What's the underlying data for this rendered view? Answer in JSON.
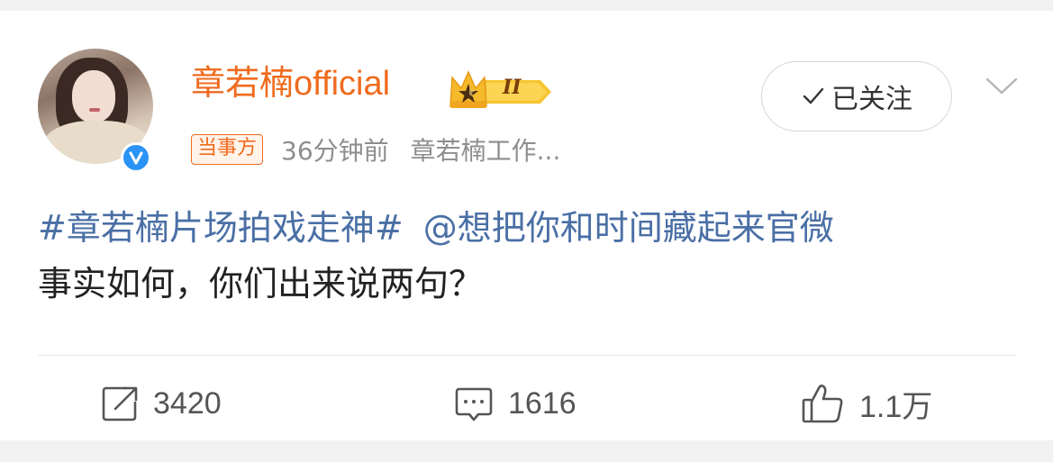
{
  "post": {
    "author_name": "章若楠official",
    "vip_badge_text": "II",
    "tag": "当事方",
    "time": "36分钟前",
    "source": "章若楠工作...",
    "follow_label": "已关注",
    "hashtag": "#章若楠片场拍戏走神#",
    "mention": "@想把你和时间藏起来官微",
    "body_text": "事实如何，你们出来说两句？"
  },
  "actions": {
    "repost_count": "3420",
    "comment_count": "1616",
    "like_count": "1.1万"
  },
  "icons": {
    "verified": "verified-v-icon",
    "more": "chevron-down-icon",
    "repost": "share-arrow-icon",
    "comment": "comment-bubble-icon",
    "like": "thumbs-up-icon"
  },
  "colors": {
    "accent": "#f06b1e",
    "link": "#4a6fa5",
    "verified": "#2b93f5"
  }
}
